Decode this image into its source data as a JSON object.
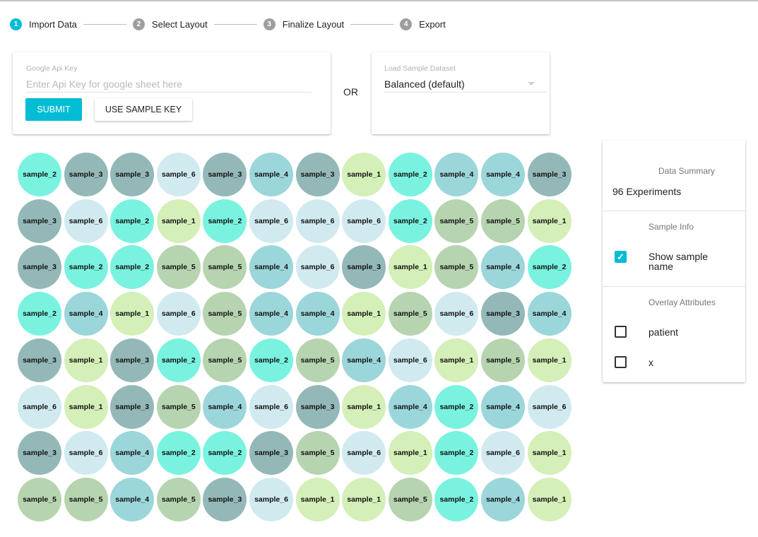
{
  "accent_color": "#00bcd4",
  "step_inactive_color": "#9e9e9e",
  "stepper": {
    "steps": [
      {
        "num": "1",
        "label": "Import Data",
        "active": true
      },
      {
        "num": "2",
        "label": "Select Layout",
        "active": false
      },
      {
        "num": "3",
        "label": "Finalize Layout",
        "active": false
      },
      {
        "num": "4",
        "label": "Export",
        "active": false
      }
    ]
  },
  "api_card": {
    "label": "Google Api Key",
    "placeholder": "Enter Api Key for google sheet here",
    "value": "",
    "submit_label": "SUBMIT",
    "sample_key_label": "USE SAMPLE KEY"
  },
  "or_text": "OR",
  "dataset_card": {
    "label": "Load Sample Dataset",
    "selected": "Balanced (default)"
  },
  "sample_colors": {
    "sample_1": "#d4efb8",
    "sample_2": "#79f3df",
    "sample_3": "#94b8b8",
    "sample_4": "#9bd6da",
    "sample_5": "#b6d4af",
    "sample_6": "#d0eaf0"
  },
  "plate": {
    "rows": [
      [
        "sample_2",
        "sample_3",
        "sample_3",
        "sample_6",
        "sample_3",
        "sample_4",
        "sample_3",
        "sample_1",
        "sample_2",
        "sample_4",
        "sample_4",
        "sample_3"
      ],
      [
        "sample_3",
        "sample_6",
        "sample_2",
        "sample_1",
        "sample_2",
        "sample_6",
        "sample_6",
        "sample_6",
        "sample_2",
        "sample_5",
        "sample_5",
        "sample_1"
      ],
      [
        "sample_3",
        "sample_2",
        "sample_2",
        "sample_5",
        "sample_5",
        "sample_4",
        "sample_6",
        "sample_3",
        "sample_1",
        "sample_5",
        "sample_4",
        "sample_2"
      ],
      [
        "sample_2",
        "sample_4",
        "sample_1",
        "sample_6",
        "sample_5",
        "sample_4",
        "sample_4",
        "sample_1",
        "sample_5",
        "sample_6",
        "sample_3",
        "sample_4"
      ],
      [
        "sample_3",
        "sample_1",
        "sample_3",
        "sample_2",
        "sample_5",
        "sample_2",
        "sample_5",
        "sample_4",
        "sample_6",
        "sample_1",
        "sample_5",
        "sample_1"
      ],
      [
        "sample_6",
        "sample_1",
        "sample_3",
        "sample_5",
        "sample_4",
        "sample_6",
        "sample_3",
        "sample_1",
        "sample_4",
        "sample_2",
        "sample_4",
        "sample_6"
      ],
      [
        "sample_3",
        "sample_6",
        "sample_4",
        "sample_2",
        "sample_2",
        "sample_3",
        "sample_5",
        "sample_6",
        "sample_1",
        "sample_2",
        "sample_6",
        "sample_1"
      ],
      [
        "sample_5",
        "sample_5",
        "sample_4",
        "sample_5",
        "sample_3",
        "sample_6",
        "sample_1",
        "sample_1",
        "sample_5",
        "sample_2",
        "sample_4",
        "sample_1"
      ]
    ]
  },
  "side_panel": {
    "summary_title": "Data Summary",
    "experiments": "96 Experiments",
    "sample_info_title": "Sample Info",
    "show_sample_name_label": "Show sample name",
    "show_sample_name_checked": true,
    "overlay_title": "Overlay Attributes",
    "overlay_attributes": [
      {
        "label": "patient",
        "checked": false
      },
      {
        "label": "x",
        "checked": false
      }
    ]
  }
}
